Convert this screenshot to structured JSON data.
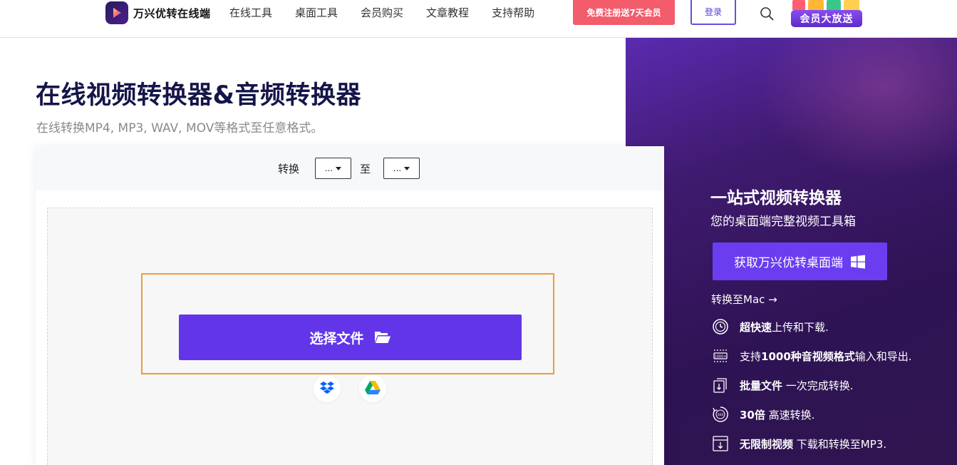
{
  "header": {
    "brand_name": "万兴优转在线端",
    "nav": [
      "在线工具",
      "桌面工具",
      "会员购买",
      "文章教程",
      "支持帮助"
    ],
    "register_label": "免费注册送7天会员",
    "login_label": "登录",
    "promo_label": "会员大放送"
  },
  "hero": {
    "title": "在线视频转换器&音频转换器",
    "subtitle": "在线转换MP4, MP3, WAV, MOV等格式至任意格式。"
  },
  "converter": {
    "convert_label": "转换",
    "from_value": "...",
    "to_label": "至",
    "to_value": "...",
    "choose_label": "选择文件"
  },
  "side": {
    "title": "一站式视频转换器",
    "subtitle": "您的桌面端完整视频工具箱",
    "desktop_button": "获取万兴优转桌面端",
    "mac_link": "转换至Mac →",
    "features": [
      {
        "bold": "超快速",
        "text": "上传和下载."
      },
      {
        "prefix": "支持",
        "bold": "1000种音视频格式",
        "text": "输入和导出."
      },
      {
        "bold": "批量文件",
        "text": " 一次完成转换."
      },
      {
        "bold": "30倍",
        "text": " 高速转换."
      },
      {
        "bold": "无限制视频",
        "text": " 下载和转换至MP3."
      }
    ]
  },
  "colors": {
    "accent": "#6236e8",
    "register_red": "#f25c6b",
    "highlight_orange": "#f09a3e",
    "panel_purple": "#2e1354"
  }
}
